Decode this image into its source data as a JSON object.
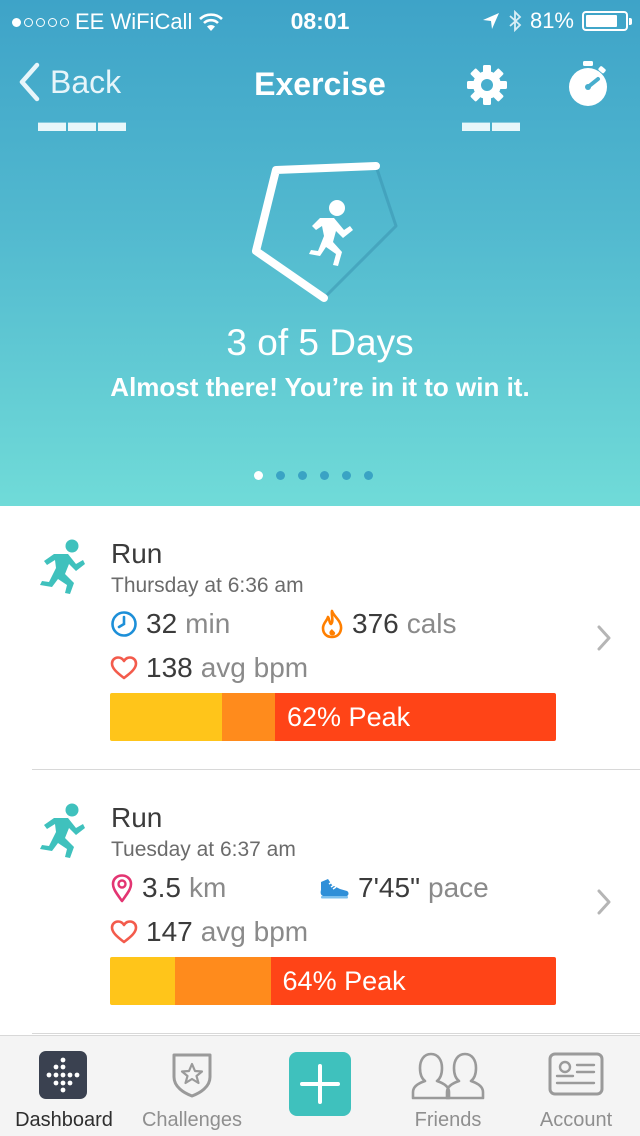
{
  "status_bar": {
    "carrier": "EE WiFiCall",
    "time": "08:01",
    "battery": "81%",
    "battery_level": 0.81,
    "signal_bars": 1
  },
  "nav": {
    "back_label": "Back",
    "title": "Exercise"
  },
  "hero": {
    "goal_text": "3 of 5 Days",
    "message": "Almost there! You’re in it to win it.",
    "progress_days": 3,
    "goal_days": 5,
    "page_count": 6,
    "active_page": 0
  },
  "exercises": [
    {
      "name": "Run",
      "when": "Thursday at 6:36 am",
      "stat1_value": "32",
      "stat1_unit": "min",
      "stat2_value": "376",
      "stat2_unit": "cals",
      "bpm_value": "138",
      "bpm_unit": "avg bpm",
      "peak_label": "62% Peak",
      "zones": {
        "fat_burn": 25,
        "cardio": 12,
        "peak": 63
      }
    },
    {
      "name": "Run",
      "when": "Tuesday at 6:37 am",
      "stat1_value": "3.5",
      "stat1_unit": "km",
      "stat2_value": "7'45\"",
      "stat2_unit": "pace",
      "bpm_value": "147",
      "bpm_unit": "avg bpm",
      "peak_label": "64% Peak",
      "zones": {
        "fat_burn": 14.5,
        "cardio": 21.5,
        "peak": 64
      }
    }
  ],
  "tabs": [
    {
      "label": "Dashboard",
      "active": true
    },
    {
      "label": "Challenges",
      "active": false
    },
    {
      "label": "",
      "active": false
    },
    {
      "label": "Friends",
      "active": false
    },
    {
      "label": "Account",
      "active": false
    }
  ],
  "colors": {
    "teal": "#3fc1bd",
    "fat_burn_zone": "#ffc51a",
    "cardio_zone": "#ff8b1c",
    "peak_zone": "#ff4417",
    "clock": "#1d8fd8",
    "flame": "#ff7f00",
    "heart": "#f35b4c",
    "location": "#e33572",
    "shoe": "#2f8fd8"
  }
}
